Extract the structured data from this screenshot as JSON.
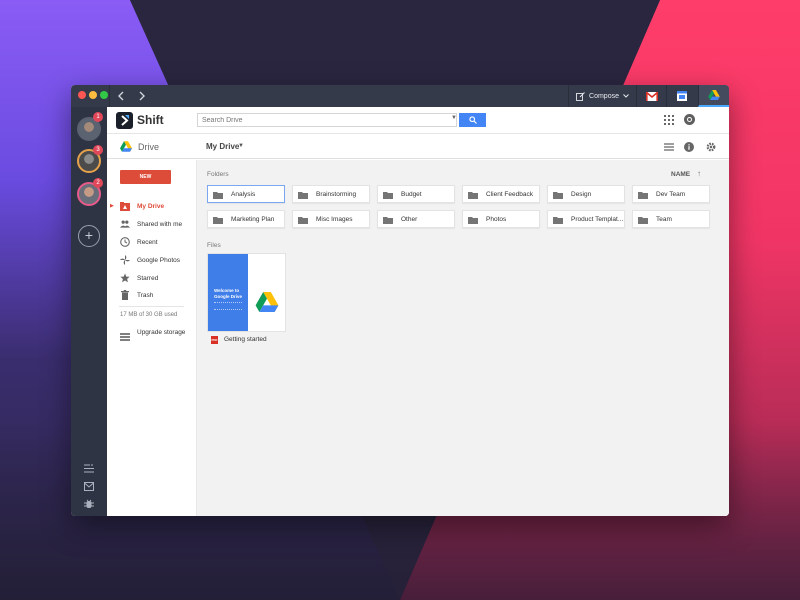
{
  "titlebar": {
    "compose_label": "Compose"
  },
  "rail": {
    "badges": [
      "1",
      "3",
      "2"
    ],
    "add_label": "+"
  },
  "header": {
    "app_name": "Shift",
    "search_placeholder": "Search Drive"
  },
  "subheader": {
    "app_name": "Drive",
    "location": "My Drive"
  },
  "sidebar": {
    "new_label": "NEW",
    "items": [
      {
        "label": "My Drive",
        "icon": "my-drive-icon"
      },
      {
        "label": "Shared with me",
        "icon": "people-icon"
      },
      {
        "label": "Recent",
        "icon": "clock-icon"
      },
      {
        "label": "Google Photos",
        "icon": "pinwheel-icon"
      },
      {
        "label": "Starred",
        "icon": "star-icon"
      },
      {
        "label": "Trash",
        "icon": "trash-icon"
      }
    ],
    "storage_text": "17 MB of 30 GB used",
    "upgrade_label": "Upgrade storage"
  },
  "main": {
    "folders_label": "Folders",
    "files_label": "Files",
    "sort_label": "NAME",
    "folders": [
      {
        "name": "Analysis"
      },
      {
        "name": "Brainstorming"
      },
      {
        "name": "Budget"
      },
      {
        "name": "Client Feedback"
      },
      {
        "name": "Design"
      },
      {
        "name": "Dev Team"
      },
      {
        "name": "Marketing Plan"
      },
      {
        "name": "Misc Images"
      },
      {
        "name": "Other"
      },
      {
        "name": "Photos"
      },
      {
        "name": "Product Templat..."
      },
      {
        "name": "Team"
      }
    ],
    "files": [
      {
        "name": "Getting started",
        "type_badge": "PDF",
        "thumb_title": "Welcome to Google Drive"
      }
    ]
  },
  "colors": {
    "accent_red": "#dd4b39",
    "accent_blue": "#4385f5",
    "titlebar": "#353a4a",
    "rail": "#2f3444"
  }
}
